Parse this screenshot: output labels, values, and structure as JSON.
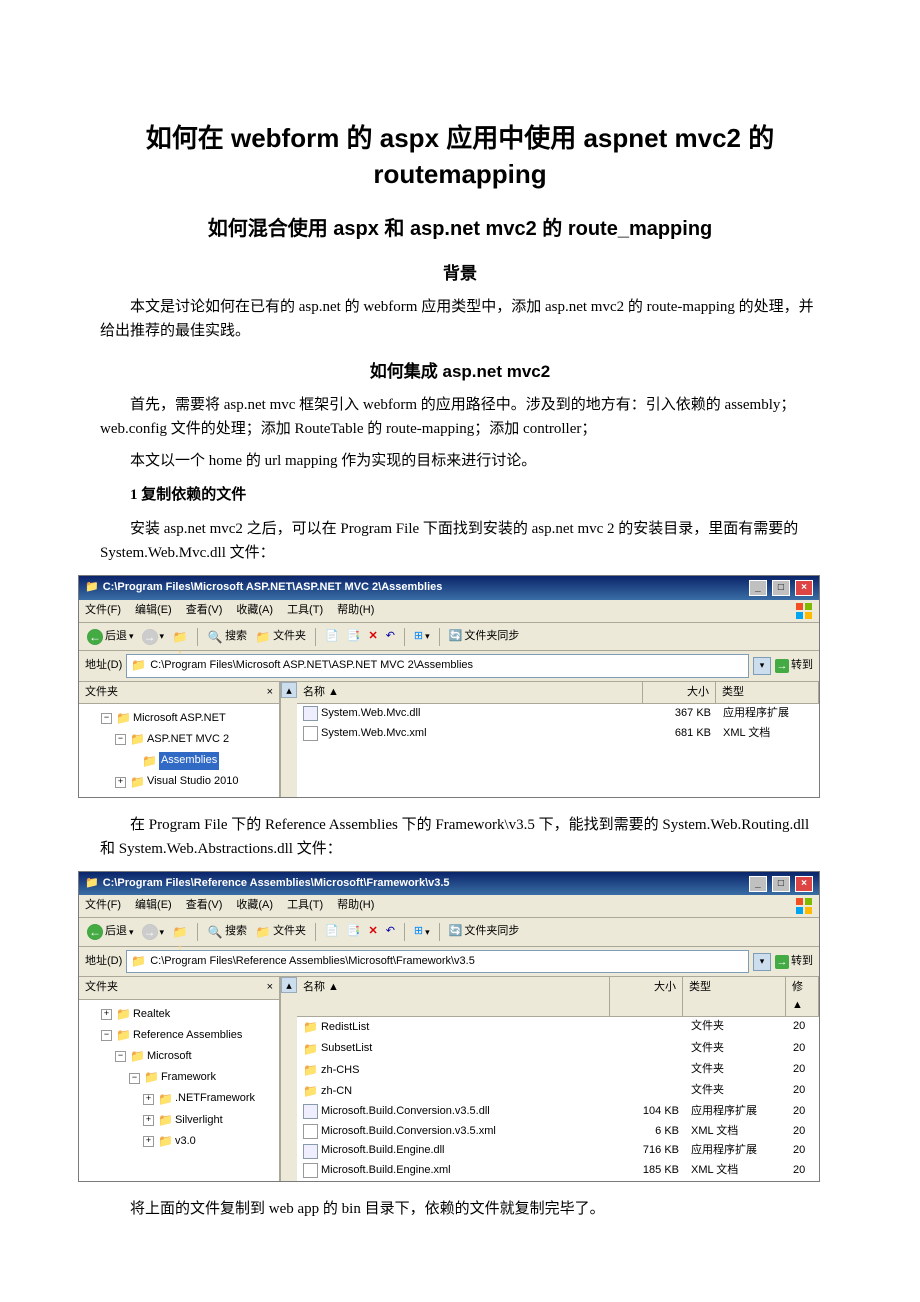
{
  "title": "如何在 webform 的 aspx 应用中使用 aspnet mvc2 的 routemapping",
  "subtitle": "如何混合使用 aspx 和 asp.net mvc2 的 route_mapping",
  "section_bg": "背景",
  "para_bg": "本文是讨论如何在已有的 asp.net 的 webform 应用类型中，添加 asp.net mvc2 的 route-mapping 的处理，并给出推荐的最佳实践。",
  "section_how": "如何集成 asp.net mvc2",
  "para_how1": "首先，需要将 asp.net mvc 框架引入 webform 的应用路径中。涉及到的地方有：引入依赖的 assembly；web.config 文件的处理；添加 RouteTable 的 route-mapping；添加 controller；",
  "para_how2": "本文以一个 home 的 url mapping 作为实现的目标来进行讨论。",
  "section_copy": "1 复制依赖的文件",
  "para_copy1": "安装 asp.net mvc2 之后，可以在 Program File 下面找到安装的 asp.net mvc 2 的安装目录，里面有需要的 System.Web.Mvc.dll 文件：",
  "para_mid": "在 Program File 下的 Reference Assemblies 下的 Framework\\v3.5 下，能找到需要的 System.Web.Routing.dll 和 System.Web.Abstractions.dll 文件：",
  "para_end": "将上面的文件复制到 web app 的 bin 目录下，依赖的文件就复制完毕了。",
  "explorer1": {
    "title": "C:\\Program Files\\Microsoft ASP.NET\\ASP.NET MVC 2\\Assemblies",
    "menus": [
      "文件(F)",
      "编辑(E)",
      "查看(V)",
      "收藏(A)",
      "工具(T)",
      "帮助(H)"
    ],
    "back": "后退",
    "search": "搜索",
    "folders": "文件夹",
    "sync": "文件夹同步",
    "addr_label": "地址(D)",
    "addr_path": "C:\\Program Files\\Microsoft ASP.NET\\ASP.NET MVC 2\\Assemblies",
    "go": "转到",
    "tree_header": "文件夹",
    "tree": [
      {
        "indent": 1,
        "pm": "−",
        "label": "Microsoft ASP.NET"
      },
      {
        "indent": 2,
        "pm": "−",
        "label": "ASP.NET MVC 2"
      },
      {
        "indent": 3,
        "pm": "",
        "label": "Assemblies",
        "selected": true
      },
      {
        "indent": 2,
        "pm": "+",
        "label": "Visual Studio 2010"
      }
    ],
    "cols": {
      "name": "名称 ▲",
      "size": "大小",
      "type": "类型"
    },
    "rows": [
      {
        "icon": "dll",
        "name": "System.Web.Mvc.dll",
        "size": "367 KB",
        "type": "应用程序扩展"
      },
      {
        "icon": "xml",
        "name": "System.Web.Mvc.xml",
        "size": "681 KB",
        "type": "XML 文档"
      }
    ]
  },
  "explorer2": {
    "title": "C:\\Program Files\\Reference Assemblies\\Microsoft\\Framework\\v3.5",
    "menus": [
      "文件(F)",
      "编辑(E)",
      "查看(V)",
      "收藏(A)",
      "工具(T)",
      "帮助(H)"
    ],
    "back": "后退",
    "search": "搜索",
    "folders": "文件夹",
    "sync": "文件夹同步",
    "addr_label": "地址(D)",
    "addr_path": "C:\\Program Files\\Reference Assemblies\\Microsoft\\Framework\\v3.5",
    "go": "转到",
    "tree_header": "文件夹",
    "tree": [
      {
        "indent": 1,
        "pm": "+",
        "label": "Realtek"
      },
      {
        "indent": 1,
        "pm": "−",
        "label": "Reference Assemblies"
      },
      {
        "indent": 2,
        "pm": "−",
        "label": "Microsoft"
      },
      {
        "indent": 3,
        "pm": "−",
        "label": "Framework"
      },
      {
        "indent": 4,
        "pm": "+",
        "label": ".NETFramework"
      },
      {
        "indent": 4,
        "pm": "+",
        "label": "Silverlight"
      },
      {
        "indent": 4,
        "pm": "+",
        "label": "v3.0"
      }
    ],
    "cols": {
      "name": "名称 ▲",
      "size": "大小",
      "type": "类型",
      "mod": "修▲"
    },
    "rows": [
      {
        "icon": "folder",
        "name": "RedistList",
        "size": "",
        "type": "文件夹",
        "mod": "20"
      },
      {
        "icon": "folder",
        "name": "SubsetList",
        "size": "",
        "type": "文件夹",
        "mod": "20"
      },
      {
        "icon": "folder",
        "name": "zh-CHS",
        "size": "",
        "type": "文件夹",
        "mod": "20"
      },
      {
        "icon": "folder",
        "name": "zh-CN",
        "size": "",
        "type": "文件夹",
        "mod": "20"
      },
      {
        "icon": "dll",
        "name": "Microsoft.Build.Conversion.v3.5.dll",
        "size": "104 KB",
        "type": "应用程序扩展",
        "mod": "20"
      },
      {
        "icon": "xml",
        "name": "Microsoft.Build.Conversion.v3.5.xml",
        "size": "6 KB",
        "type": "XML 文档",
        "mod": "20"
      },
      {
        "icon": "dll",
        "name": "Microsoft.Build.Engine.dll",
        "size": "716 KB",
        "type": "应用程序扩展",
        "mod": "20"
      },
      {
        "icon": "xml",
        "name": "Microsoft.Build.Engine.xml",
        "size": "185 KB",
        "type": "XML 文档",
        "mod": "20"
      }
    ]
  }
}
